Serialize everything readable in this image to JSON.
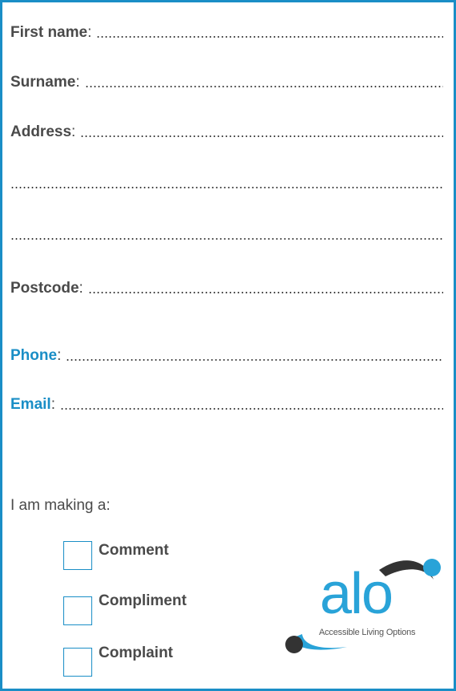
{
  "form": {
    "first_name_label": "First name",
    "surname_label": "Surname",
    "address_label": "Address",
    "postcode_label": "Postcode",
    "phone_label": "Phone",
    "email_label": "Email",
    "colon": ":"
  },
  "prompt": "I am making a:",
  "options": [
    {
      "label": "Comment"
    },
    {
      "label": "Compliment"
    },
    {
      "label": "Complaint"
    }
  ],
  "logo": {
    "wordmark": "alo",
    "tagline": "Accessible Living Options"
  },
  "colors": {
    "accent": "#1a8ec6",
    "text": "#4a4a4a",
    "logo_blue": "#29a3d8",
    "logo_dark": "#333333"
  }
}
